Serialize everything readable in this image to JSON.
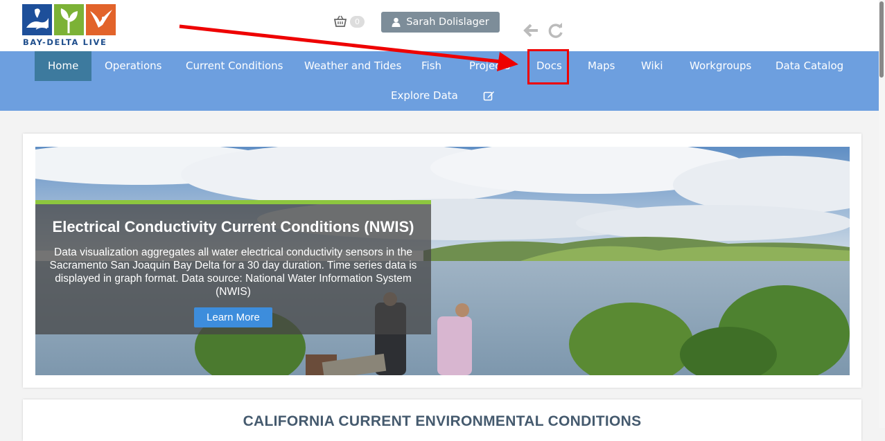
{
  "logo": {
    "text": "BAY-DELTA LIVE"
  },
  "header": {
    "cart_count": "0",
    "user_name": "Sarah Dolislager",
    "cart_icon": "basket-icon",
    "user_icon": "user-icon",
    "back_icon": "arrow-left-icon",
    "redo_icon": "redo-icon"
  },
  "nav": {
    "items": [
      {
        "label": "Home",
        "active": true
      },
      {
        "label": "Operations"
      },
      {
        "label": "Current Conditions"
      },
      {
        "label": "Weather and Tides"
      },
      {
        "label": "Fish"
      },
      {
        "label": "Projects"
      },
      {
        "label": "Docs"
      },
      {
        "label": "Maps"
      },
      {
        "label": "Wiki"
      },
      {
        "label": "Workgroups"
      },
      {
        "label": "Data Catalog"
      },
      {
        "label": "Explore Data"
      }
    ],
    "edit_icon": "edit-icon"
  },
  "hero": {
    "title": "Electrical Conductivity Current Conditions (NWIS)",
    "description": "Data visualization aggregates all water electrical conductivity sensors in the Sacramento San Joaquin Bay Delta for a 30 day duration. Time series data is displayed in graph format. Data source: National Water Information System (NWIS)",
    "button_label": "Learn More"
  },
  "section": {
    "title": "CALIFORNIA CURRENT ENVIRONMENTAL CONDITIONS"
  },
  "colors": {
    "navbar": "#6d9fdf",
    "nav_active": "#3d7a9e",
    "annotation": "#ee0000",
    "overlay_accent": "#8dc63f",
    "button": "#3d8ddc"
  }
}
